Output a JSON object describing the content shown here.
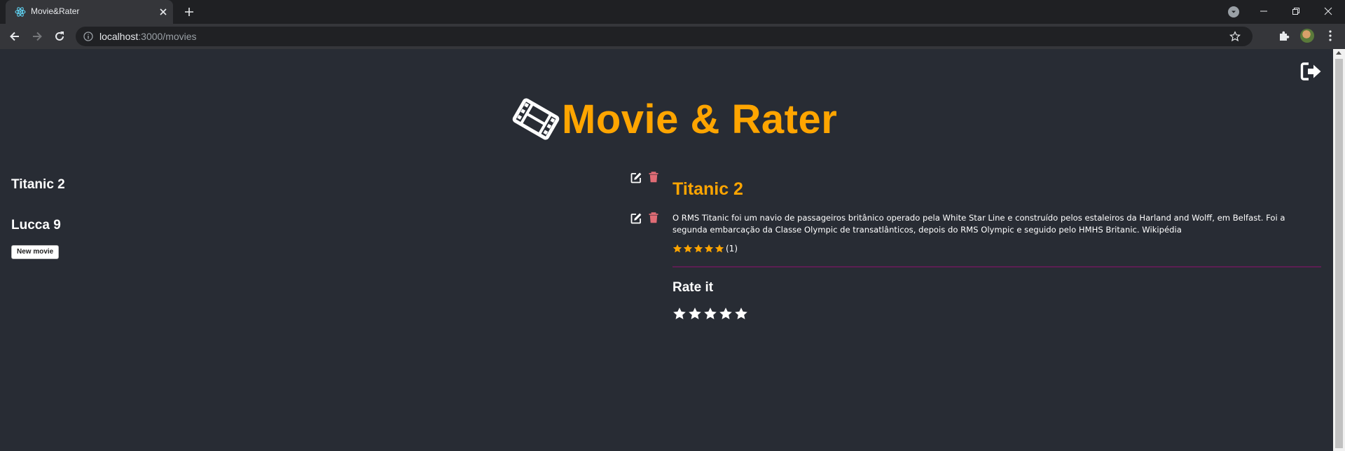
{
  "browser": {
    "tab_title": "Movie&Rater",
    "url_host": "localhost",
    "url_path": ":3000/movies"
  },
  "app": {
    "title": "Movie & Rater",
    "brand_color": "#ffa500"
  },
  "movies": [
    {
      "title": "Titanic 2"
    },
    {
      "title": "Lucca 9"
    }
  ],
  "new_movie_label": "New movie",
  "detail": {
    "title": "Titanic 2",
    "description": "O RMS Titanic foi um navio de passageiros britânico operado pela White Star Line e construído pelos estaleiros da Harland and Wolff, em Belfast. Foi a segunda embarcação da Classe Olympic de transatlânticos, depois do RMS Olympic e seguido pelo HMHS Britanic. Wikipédia",
    "avg_rating": 5,
    "max_rating": 5,
    "rating_count": "(1)"
  },
  "rate": {
    "title": "Rate it",
    "user_rating": 0,
    "max_rating": 5
  },
  "icons": {
    "edit": "edit-icon",
    "delete": "trash-icon",
    "logout": "sign-out-icon",
    "film": "film-icon"
  },
  "colors": {
    "background": "#282c34",
    "accent": "#ffa500",
    "delete": "#e06c75",
    "divider": "#5d1e52"
  }
}
